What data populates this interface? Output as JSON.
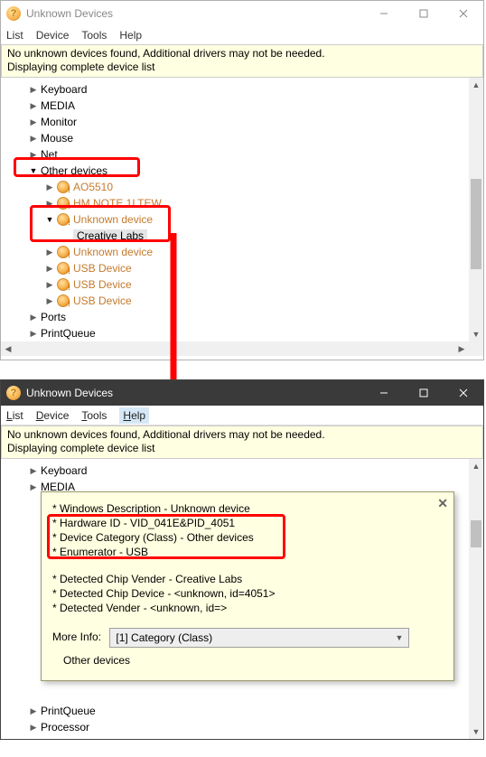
{
  "win1": {
    "title": "Unknown Devices",
    "menu": [
      "List",
      "Device",
      "Tools",
      "Help"
    ],
    "status_line1": "No unknown devices found, Additional drivers may not be needed.",
    "status_line2": "Displaying complete device list",
    "tree": {
      "keyboard": "Keyboard",
      "media": "MEDIA",
      "monitor": "Monitor",
      "mouse": "Mouse",
      "net": "Net",
      "other": "Other devices",
      "ao5510": "AO5510",
      "hmnote": "HM NOTE 1LTEW",
      "unknown1": "Unknown device",
      "creative": "Creative Labs",
      "unknown2": "Unknown device",
      "usb1": "USB Device",
      "usb2": "USB Device",
      "usb3": "USB Device",
      "ports": "Ports",
      "printqueue": "PrintQueue"
    }
  },
  "win2": {
    "title": "Unknown Devices",
    "menu": [
      "List",
      "Device",
      "Tools",
      "Help"
    ],
    "status_line1": "No unknown devices found, Additional drivers may not be needed.",
    "status_line2": "Displaying complete device list",
    "tree": {
      "keyboard": "Keyboard",
      "media": "MEDIA",
      "printqueue": "PrintQueue",
      "processor": "Processor"
    },
    "tooltip": {
      "l1": "* Windows Description - Unknown device",
      "l2": "* Hardware ID - VID_041E&PID_4051",
      "l3": "* Device Category (Class) - Other devices",
      "l4": "* Enumerator - USB",
      "l5": "* Detected Chip Vender - Creative Labs",
      "l6": "* Detected Chip Device - <unknown, id=4051>",
      "l7": "* Detected Vender - <unknown, id=>",
      "moreinfo_label": "More Info:",
      "dropdown_value": "[1] Category (Class)",
      "result": "Other devices"
    }
  }
}
